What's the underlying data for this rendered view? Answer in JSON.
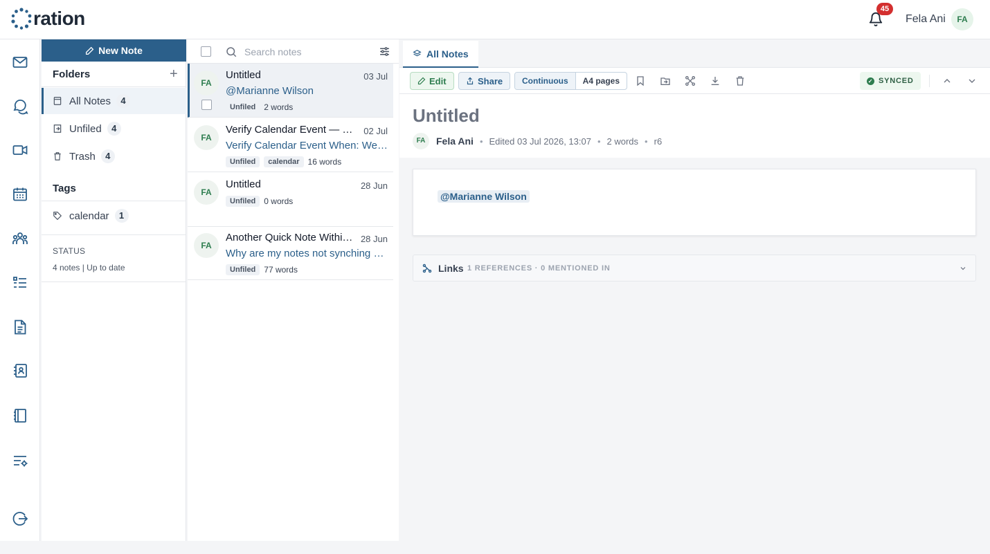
{
  "app": {
    "logo_text": "ration"
  },
  "header": {
    "notification_count": "45",
    "user_name": "Fela Ani",
    "user_initials": "FA"
  },
  "rail": {
    "icons": [
      "mail-icon",
      "chat-icon",
      "video-icon",
      "calendar-icon",
      "people-icon",
      "tasks-icon",
      "notes-icon",
      "contacts-icon",
      "notebook-icon",
      "settings-list-icon",
      "logout-icon"
    ]
  },
  "folders": {
    "new_note_label": "New Note",
    "heading": "Folders",
    "add_symbol": "+",
    "items": [
      {
        "label": "All Notes",
        "count": "4"
      },
      {
        "label": "Unfiled",
        "count": "4"
      },
      {
        "label": "Trash",
        "count": "4"
      }
    ],
    "tags_heading": "Tags",
    "tags": [
      {
        "label": "calendar",
        "count": "1"
      }
    ],
    "status_heading": "STATUS",
    "status_text": "4 notes | Up to date"
  },
  "notelist": {
    "search_placeholder": "Search notes",
    "notes": [
      {
        "initials": "FA",
        "title": "Untitled",
        "date": "03 Jul",
        "snippet": "@Marianne Wilson",
        "folder": "Unfiled",
        "tag": "",
        "words": "2 words"
      },
      {
        "initials": "FA",
        "title": "Verify Calendar Event — Now Accepting",
        "date": "02 Jul",
        "snippet": "Verify Calendar Event When: Wednesday",
        "folder": "Unfiled",
        "tag": "calendar",
        "words": "16 words"
      },
      {
        "initials": "FA",
        "title": "Untitled",
        "date": "28 Jun",
        "snippet": "",
        "folder": "Unfiled",
        "tag": "",
        "words": "0 words"
      },
      {
        "initials": "FA",
        "title": "Another Quick Note Within the App",
        "date": "28 Jun",
        "snippet": "Why are my notes not synching automatically",
        "folder": "Unfiled",
        "tag": "",
        "words": "77 words"
      }
    ]
  },
  "main": {
    "tab_label": "All Notes",
    "toolbar": {
      "edit_label": "Edit",
      "share_label": "Share",
      "view_continuous": "Continuous",
      "view_a4": "A4 pages",
      "synced_label": "SYNCED"
    },
    "doc": {
      "title": "Untitled",
      "author_initials": "FA",
      "author": "Fela Ani",
      "edited": "Edited 03 Jul 2026, 13:07",
      "words": "2 words",
      "revision": "r6",
      "body_mention": "@Marianne Wilson"
    },
    "links": {
      "label": "Links",
      "summary": "1 REFERENCES · 0 MENTIONED IN"
    }
  },
  "colors": {
    "primary": "#2b5f8a",
    "success": "#2e7d4f",
    "badge": "#d32f2f"
  }
}
